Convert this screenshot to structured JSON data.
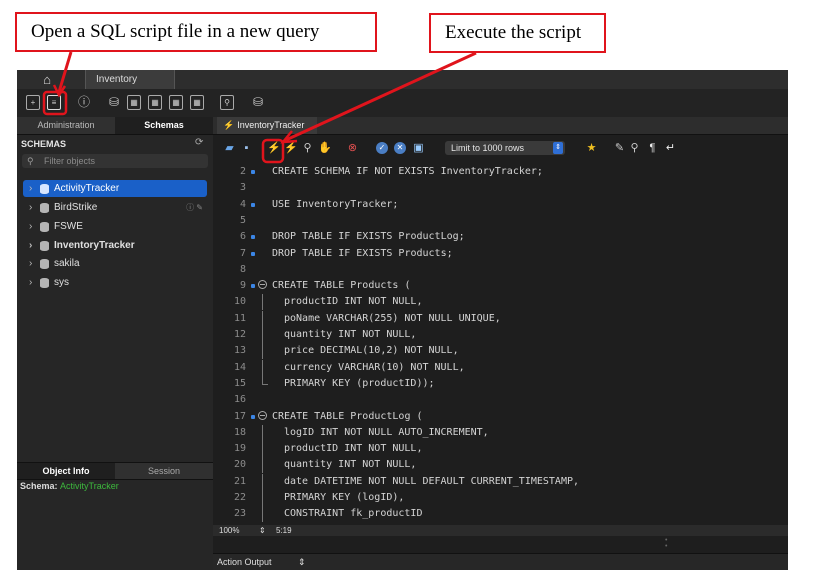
{
  "callouts": {
    "open_script": "Open a SQL script file in a new query",
    "execute": "Execute the script"
  },
  "colors": {
    "callout_red": "#e0141c",
    "selection_blue": "#1a60c8",
    "schema_green": "#3db93d"
  },
  "tabs": {
    "home_icon": "home-icon",
    "connection": "Inventory"
  },
  "sidebar": {
    "tab_admin": "Administration",
    "tab_schemas": "Schemas",
    "header": "SCHEMAS",
    "filter_placeholder": "Filter objects",
    "schemas": [
      "ActivityTracker",
      "BirdStrike",
      "FSWE",
      "InventoryTracker",
      "sakila",
      "sys"
    ],
    "info_tabs": [
      "Object Info",
      "Session"
    ],
    "schema_label": "Schema:",
    "schema_value": "ActivityTracker"
  },
  "editor": {
    "query_tab": "InventoryTracker",
    "limit": "Limit to 1000 rows",
    "lines": [
      {
        "n": "2",
        "t": "CREATE SCHEMA IF NOT EXISTS InventoryTracker;"
      },
      {
        "n": "3",
        "t": ""
      },
      {
        "n": "4",
        "t": "USE InventoryTracker;"
      },
      {
        "n": "5",
        "t": ""
      },
      {
        "n": "6",
        "t": "DROP TABLE IF EXISTS ProductLog;"
      },
      {
        "n": "7",
        "t": "DROP TABLE IF EXISTS Products;"
      },
      {
        "n": "8",
        "t": ""
      },
      {
        "n": "9",
        "t": "CREATE TABLE Products ("
      },
      {
        "n": "10",
        "t": "productID INT NOT NULL,"
      },
      {
        "n": "11",
        "t": "poName VARCHAR(255) NOT NULL UNIQUE,"
      },
      {
        "n": "12",
        "t": "quantity INT NOT NULL,"
      },
      {
        "n": "13",
        "t": "price DECIMAL(10,2) NOT NULL,"
      },
      {
        "n": "14",
        "t": "currency VARCHAR(10) NOT NULL,"
      },
      {
        "n": "15",
        "t": "PRIMARY KEY (productID));"
      },
      {
        "n": "16",
        "t": ""
      },
      {
        "n": "17",
        "t": "CREATE TABLE ProductLog ("
      },
      {
        "n": "18",
        "t": "logID INT NOT NULL AUTO_INCREMENT,"
      },
      {
        "n": "19",
        "t": "productID INT NOT NULL,"
      },
      {
        "n": "20",
        "t": "quantity INT NOT NULL,"
      },
      {
        "n": "21",
        "t": "date DATETIME NOT NULL DEFAULT CURRENT_TIMESTAMP,"
      },
      {
        "n": "22",
        "t": "PRIMARY KEY (logID),"
      },
      {
        "n": "23",
        "t": "CONSTRAINT fk_productID"
      }
    ],
    "zoom": "100%",
    "cursor": "5:19",
    "output_label": "Action Output"
  }
}
